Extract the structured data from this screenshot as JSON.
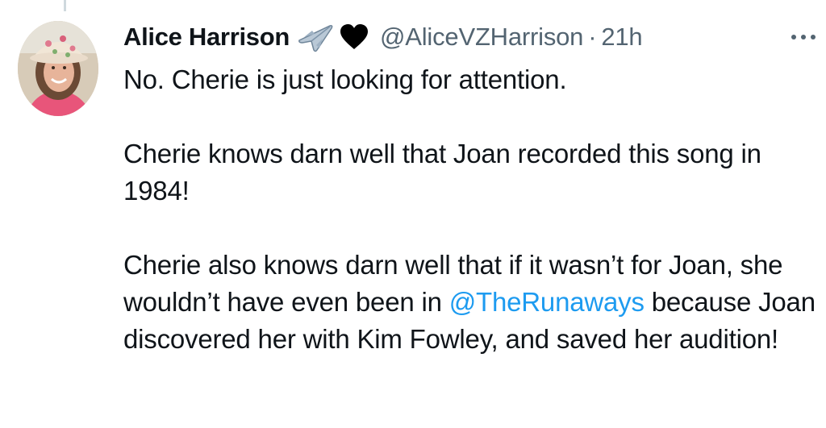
{
  "tweet": {
    "author": {
      "display_name": "Alice Harrison",
      "handle": "@AliceVZHarrison",
      "name_emojis": [
        "airplane-emoji",
        "black-heart-emoji"
      ]
    },
    "separator": "·",
    "timestamp": "21h",
    "paragraphs": [
      {
        "text": "No. Cherie is just looking for attention."
      },
      {
        "text": "Cherie knows darn well that Joan recorded this song in 1984!"
      },
      {
        "text_before": "Cherie also knows darn well that if it wasn’t for Joan, she wouldn’t have even been in ",
        "mention": "@TheRunaways",
        "text_after": " because Joan discovered her with Kim Fowley, and saved her audition!"
      }
    ]
  },
  "colors": {
    "text": "#0f1419",
    "secondary": "#536471",
    "link": "#1d9bf0",
    "thread_line": "#cfd9de"
  }
}
